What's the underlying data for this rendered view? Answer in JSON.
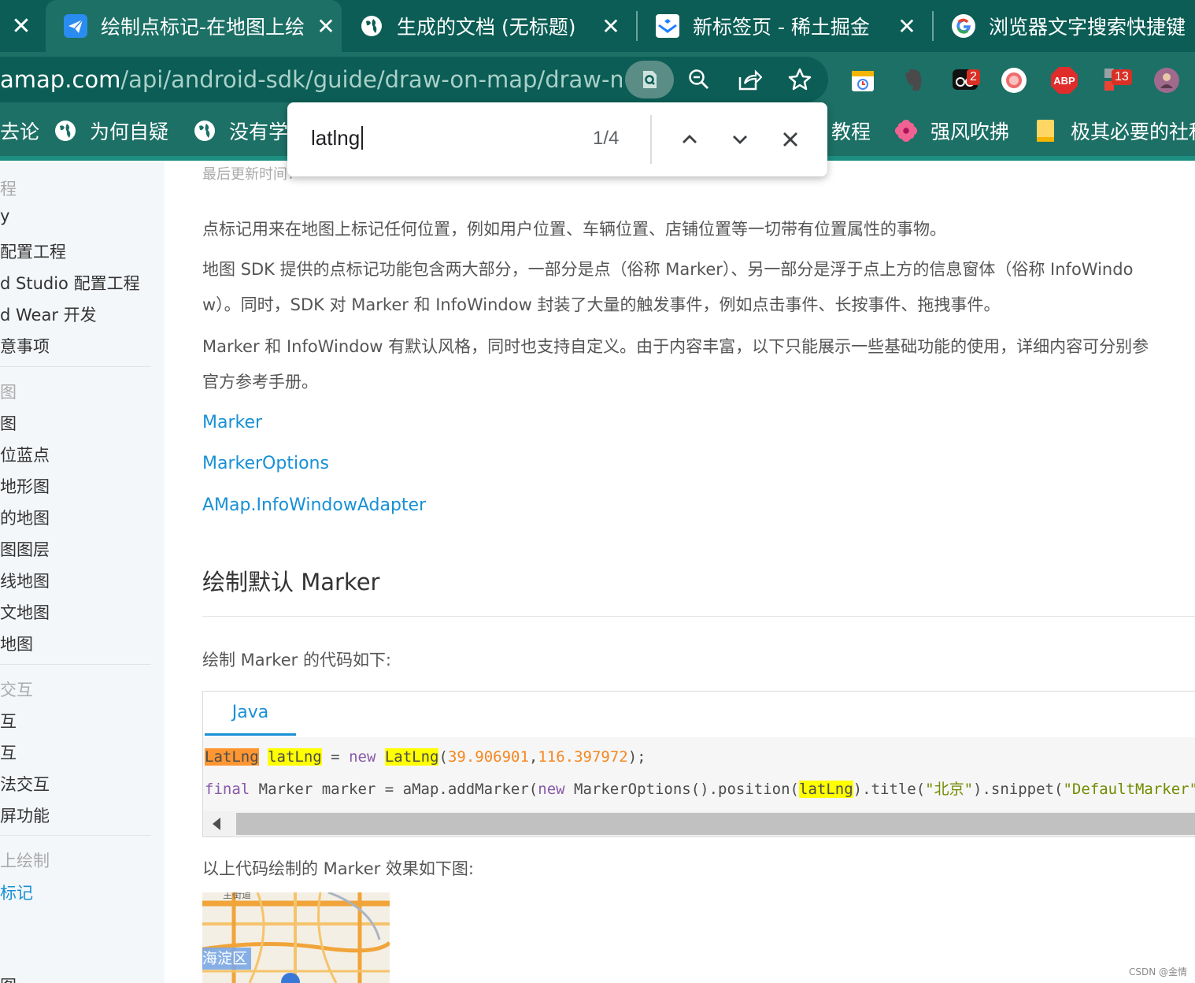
{
  "browser": {
    "tabs": [
      {
        "title": "绘制点标记-在地图上绘",
        "icon": "paper-plane-icon",
        "active": true
      },
      {
        "title": "生成的文档 (无标题)",
        "icon": "globe-icon",
        "active": false
      },
      {
        "title": "新标签页 - 稀土掘金",
        "icon": "juejin-icon",
        "active": false
      },
      {
        "title": "浏览器文字搜索快捷键",
        "icon": "google-icon",
        "active": false
      }
    ],
    "close_symbol": "✕",
    "url_host": "amap.com",
    "url_path": "/api/android-sdk/guide/draw-on-map/draw-m...",
    "extensions": {
      "ext_badge_2": "2",
      "abp_label": "ABP",
      "ext_badge_13": "13"
    },
    "bookmarks": [
      {
        "label": "去论",
        "icon": "none"
      },
      {
        "label": "为何自疑",
        "icon": "globe-icon"
      },
      {
        "label": "没有学",
        "icon": "globe-icon"
      },
      {
        "label": "教程",
        "icon": "none"
      },
      {
        "label": "强风吹拂",
        "icon": "flower-icon"
      },
      {
        "label": "极其必要的社科",
        "icon": "folder-icon"
      }
    ]
  },
  "findbar": {
    "query": "latlng",
    "count": "1/4"
  },
  "sidebar": {
    "items": [
      {
        "label": "程",
        "kind": "group"
      },
      {
        "label": "y",
        "kind": "item"
      },
      {
        "label": "配置工程",
        "kind": "item"
      },
      {
        "label": "d Studio 配置工程",
        "kind": "item"
      },
      {
        "label": "d Wear 开发",
        "kind": "item"
      },
      {
        "label": "意事项",
        "kind": "item"
      },
      {
        "label": "图",
        "kind": "group"
      },
      {
        "label": "图",
        "kind": "item"
      },
      {
        "label": "位蓝点",
        "kind": "item"
      },
      {
        "label": "地形图",
        "kind": "item"
      },
      {
        "label": "的地图",
        "kind": "item"
      },
      {
        "label": "图图层",
        "kind": "item"
      },
      {
        "label": "线地图",
        "kind": "item"
      },
      {
        "label": "文地图",
        "kind": "item"
      },
      {
        "label": "地图",
        "kind": "item"
      },
      {
        "label": "交互",
        "kind": "group"
      },
      {
        "label": "互",
        "kind": "item"
      },
      {
        "label": "互",
        "kind": "item"
      },
      {
        "label": "法交互",
        "kind": "item"
      },
      {
        "label": "屏功能",
        "kind": "item"
      },
      {
        "label": "上绘制",
        "kind": "group"
      },
      {
        "label": "标记",
        "kind": "active"
      },
      {
        "label": "图",
        "kind": "item"
      }
    ]
  },
  "content": {
    "updated": "最后更新时间：",
    "paragraphs": [
      "点标记用来在地图上标记任何位置，例如用户位置、车辆位置、店铺位置等一切带有位置属性的事物。",
      "地图 SDK 提供的点标记功能包含两大部分，一部分是点（俗称 Marker）、另一部分是浮于点上方的信息窗体（俗称 InfoWindo",
      "w）。同时，SDK 对 Marker 和 InfoWindow 封装了大量的触发事件，例如点击事件、长按事件、拖拽事件。",
      "Marker 和 InfoWindow 有默认风格，同时也支持自定义。由于内容丰富，以下只能展示一些基础功能的使用，详细内容可分别参",
      "官方参考手册。"
    ],
    "links": [
      "Marker",
      "MarkerOptions",
      "AMap.InfoWindowAdapter"
    ],
    "heading": "绘制默认 Marker",
    "code_intro": "绘制 Marker 的代码如下:",
    "code_tab": "Java",
    "code": {
      "l1_type": "LatLng",
      "l1_var": "latLng",
      "l1_eq": " = ",
      "l1_new": "new",
      "l1_ctor": "LatLng",
      "l1_open": "(",
      "l1_lat": "39.906901",
      "l1_comma": ",",
      "l1_lng": "116.397972",
      "l1_close": ");",
      "l2_final": "final",
      "l2_a": " Marker marker = aMap.addMarker(",
      "l2_new": "new",
      "l2_b": " MarkerOptions().position(",
      "l2_var": "latLng",
      "l2_c": ").title(",
      "l2_title": "\"北京\"",
      "l2_d": ").snippet(",
      "l2_snippet": "\"DefaultMarker\""
    },
    "result_intro": "以上代码绘制的 Marker 效果如下图:",
    "map_district": "海淀区",
    "map_road": "主街道"
  },
  "watermark": "CSDN @金情",
  "colors": {
    "tab_bg": "#0b5d55",
    "toolbar_bg": "#1d7066",
    "link": "#1890d6",
    "find_highlight": "#ffff00",
    "find_current": "#ff9632"
  }
}
